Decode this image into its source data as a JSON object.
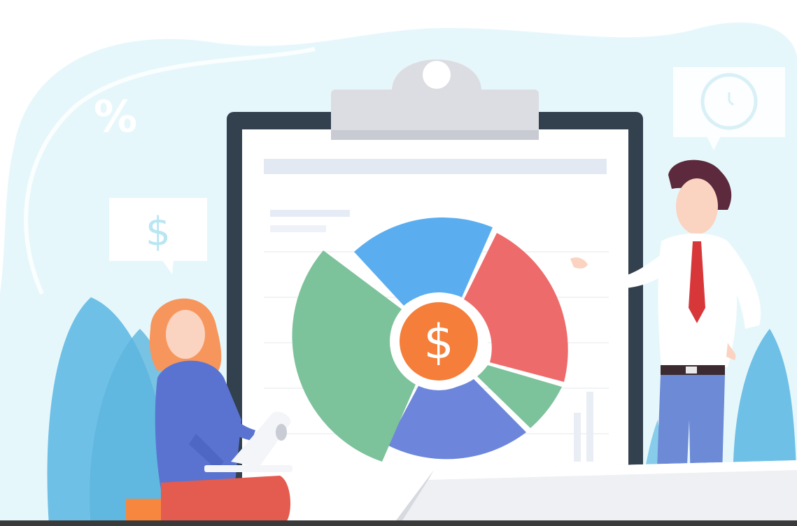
{
  "illustration": {
    "percent_symbol": "%",
    "dollar_symbol": "$",
    "pie_center_symbol": "$",
    "colors": {
      "background_blob": "#e6f7fb",
      "clipboard_frame": "#33404e",
      "clipboard_paper": "#ffffff",
      "clip": "#dcdde2",
      "pie_blue": "#5aaef0",
      "pie_red": "#ee6b6b",
      "pie_green": "#7cc29a",
      "pie_indigo": "#6d86dc",
      "coin": "#f47e3a",
      "plant": "#6fc0e6",
      "woman_hair": "#f7965c",
      "woman_sweater": "#5a73d1",
      "man_tie": "#d8373a",
      "man_pants": "#6c8ad6",
      "man_hair": "#5c2a3c"
    }
  }
}
